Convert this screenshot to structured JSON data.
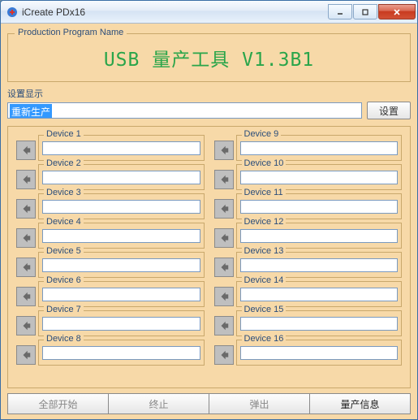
{
  "window": {
    "title": "iCreate PDx16"
  },
  "program_group": {
    "legend": "Production Program Name",
    "name": "USB 量产工具 V1.3B1"
  },
  "settings": {
    "label": "设置显示",
    "value": "重新生产",
    "button": "设置"
  },
  "devices": {
    "left": [
      {
        "label": "Device 1"
      },
      {
        "label": "Device 2"
      },
      {
        "label": "Device 3"
      },
      {
        "label": "Device 4"
      },
      {
        "label": "Device 5"
      },
      {
        "label": "Device 6"
      },
      {
        "label": "Device 7"
      },
      {
        "label": "Device 8"
      }
    ],
    "right": [
      {
        "label": "Device 9"
      },
      {
        "label": "Device 10"
      },
      {
        "label": "Device 11"
      },
      {
        "label": "Device 12"
      },
      {
        "label": "Device 13"
      },
      {
        "label": "Device 14"
      },
      {
        "label": "Device 15"
      },
      {
        "label": "Device 16"
      }
    ]
  },
  "bottom": {
    "start_all": "全部开始",
    "stop": "终止",
    "eject": "弹出",
    "info": "量产信息"
  },
  "colors": {
    "client_bg": "#f7d9a8",
    "program_text": "#2aa54a"
  }
}
